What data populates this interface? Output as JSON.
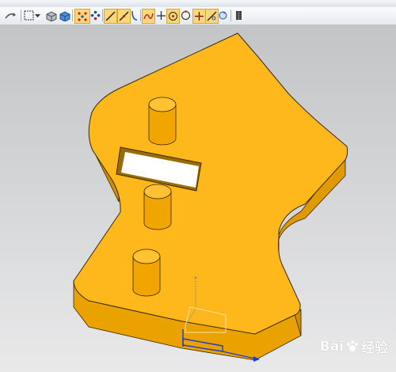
{
  "toolbar": {
    "top_icons": [
      "undo-icon",
      "redo-icon",
      "cut-icon",
      "copy-icon",
      "paste-icon",
      "view-icon",
      "layer-icon",
      "dim-icon"
    ],
    "icons": [
      "rotate-icon",
      "select-box-icon",
      "dropdown-arrow-icon",
      "shaded-view-icon",
      "solid-view-icon",
      "snap-point-icon",
      "snap-grid-icon",
      "line-icon",
      "tangent-line-icon",
      "arc-icon",
      "spline-icon",
      "perpendicular-icon",
      "circle-center-icon",
      "quadrant-icon",
      "intersection-icon",
      "tangent-icon",
      "refresh-view-icon",
      "display-toggle-icon"
    ]
  },
  "viewport": {
    "part_color": "#ffb81c",
    "part_side_color": "#e89c00",
    "edge_color": "#3a2a00",
    "background_top": "#c3c4c6",
    "background_bottom": "#e9e9ea"
  },
  "watermark": {
    "logo_text": "Bai",
    "logo_suffix": "经验"
  }
}
